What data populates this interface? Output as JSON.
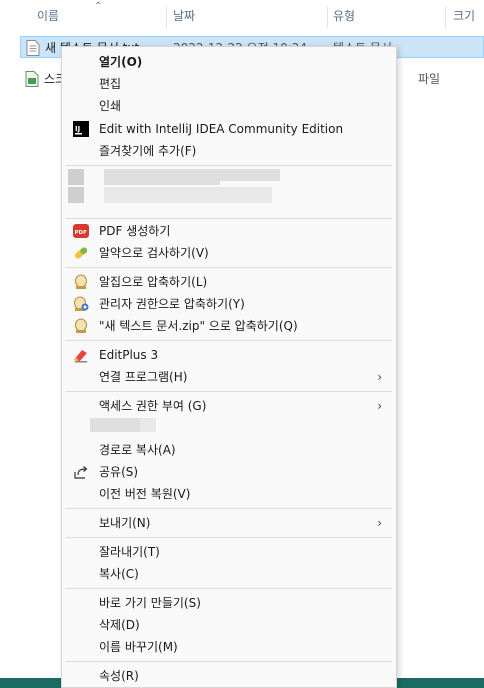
{
  "explorer": {
    "columns": {
      "name": "이름",
      "date": "날짜",
      "type": "유형",
      "size": "크기"
    },
    "files": [
      {
        "name": "새 텍스트 문서.txt",
        "date": "2022-12-22 오전 10:24",
        "type": "텍스트 문서"
      },
      {
        "name": "스크",
        "type_partial": "파일"
      }
    ]
  },
  "menu": {
    "open": "열기(O)",
    "edit": "편집",
    "print": "인쇄",
    "intellij": "Edit with IntelliJ IDEA Community Edition",
    "favorites": "즐겨찾기에 추가(F)",
    "pdf": "PDF 생성하기",
    "alyac": "알약으로 검사하기(V)",
    "zip": "알집으로 압축하기(L)",
    "zip_admin": "관리자 권한으로 압축하기(Y)",
    "zip_named": "\"새 텍스트 문서.zip\" 으로 압축하기(Q)",
    "editplus": "EditPlus 3",
    "open_with": "연결 프로그램(H)",
    "grant_access": "액세스 권한 부여 (G)",
    "copy_path": "경로로 복사(A)",
    "share": "공유(S)",
    "restore": "이전 버전 복원(V)",
    "send_to": "보내기(N)",
    "cut": "잘라내기(T)",
    "copy": "복사(C)",
    "shortcut": "바로 가기 만들기(S)",
    "delete": "삭제(D)",
    "rename": "이름 바꾸기(M)",
    "properties": "속성(R)",
    "submenu_arrow": "›",
    "icons": [
      "intellij-icon",
      "pdf-icon",
      "alyac-icon",
      "alzip-icon",
      "alzip-admin-icon",
      "alzip-icon",
      "editplus-icon",
      "share-icon"
    ]
  },
  "colors": {
    "selection": "#cce4f7",
    "menu_bg": "#f9f9f9",
    "taskbar": "#1c6b62"
  }
}
